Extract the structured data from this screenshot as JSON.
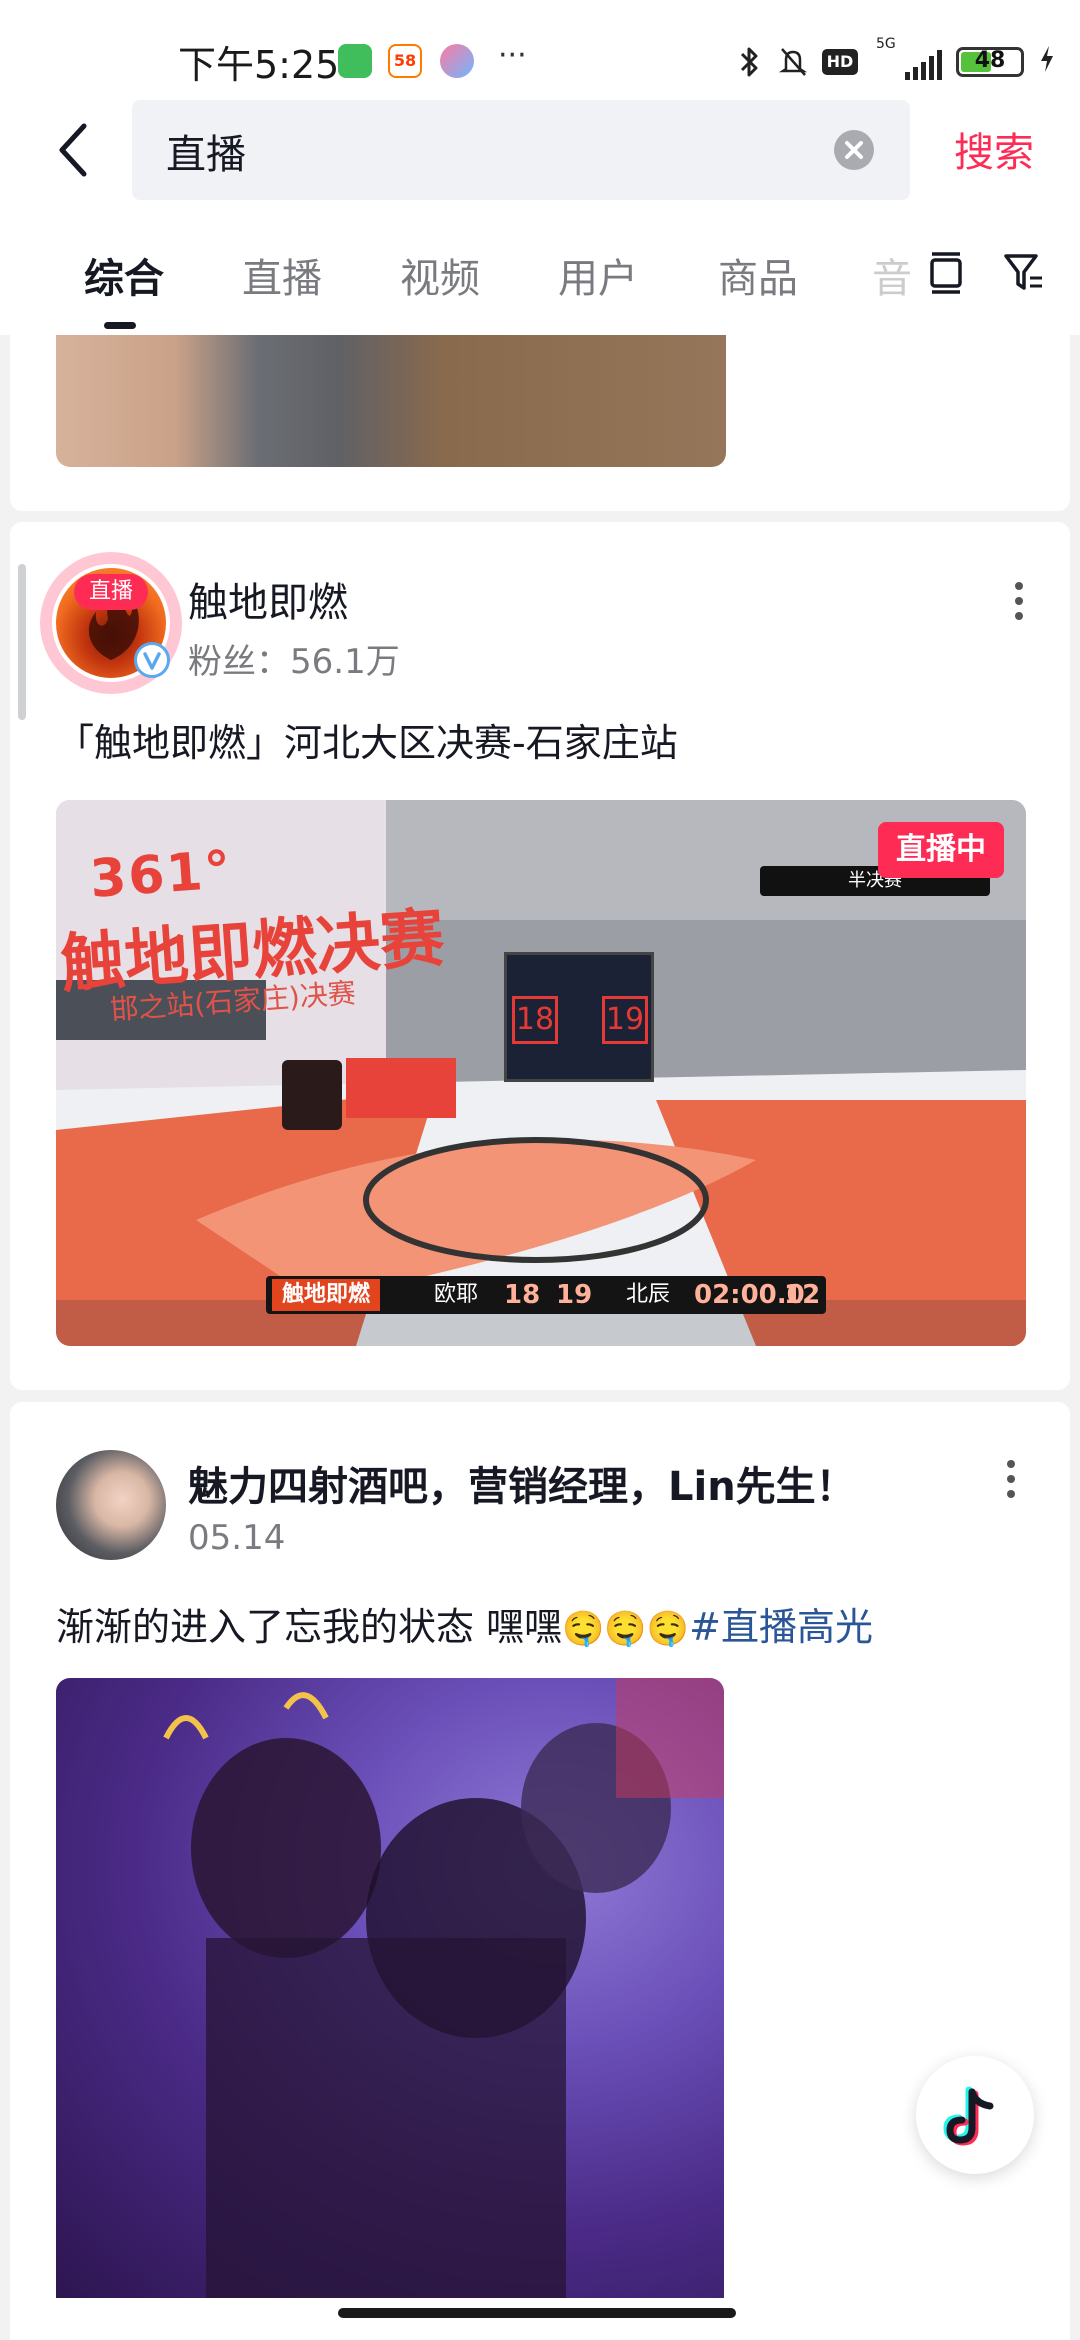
{
  "status_bar": {
    "time": "下午5:25",
    "app_58_label": "58",
    "more": "···",
    "hd": "HD",
    "network": "5G",
    "battery": "48",
    "battery_level": 0.48
  },
  "search": {
    "query": "直播",
    "button_label": "搜索"
  },
  "tabs": [
    {
      "label": "综合",
      "active": true
    },
    {
      "label": "直播",
      "active": false
    },
    {
      "label": "视频",
      "active": false
    },
    {
      "label": "用户",
      "active": false
    },
    {
      "label": "商品",
      "active": false
    },
    {
      "label": "音",
      "active": false
    }
  ],
  "live_card": {
    "avatar_badge": "直播",
    "account_name": "触地即燃",
    "fans": "粉丝：56.1万",
    "title": "「触地即燃」河北大区决赛-石家庄站",
    "live_tag": "直播中",
    "video_text": {
      "brand": "361°",
      "banner": "触地即燃决赛",
      "banner_sub": "邯之站(石家庄)决赛",
      "stage": "半决赛",
      "home_score": "18",
      "away_score": "19",
      "event": "触地即燃",
      "home_team": "欧耶",
      "away_team": "北辰",
      "game_clock": "02:00.0",
      "shot_clock": "12"
    }
  },
  "post_card": {
    "author": "魅力四射酒吧，营销经理，Lin先生！",
    "date": "05.14",
    "text": "渐渐的进入了忘我的状态 嘿嘿",
    "emojis": "🤤🤤🤤",
    "hashtag": "#直播高光"
  },
  "colors": {
    "accent": "#fe2c55",
    "hashtag": "#2a5597",
    "muted_text": "#7a7b80"
  },
  "icons": [
    "back-icon",
    "clear-icon",
    "layout-icon",
    "filter-icon",
    "more-icon",
    "verified-icon",
    "douyin-icon"
  ]
}
